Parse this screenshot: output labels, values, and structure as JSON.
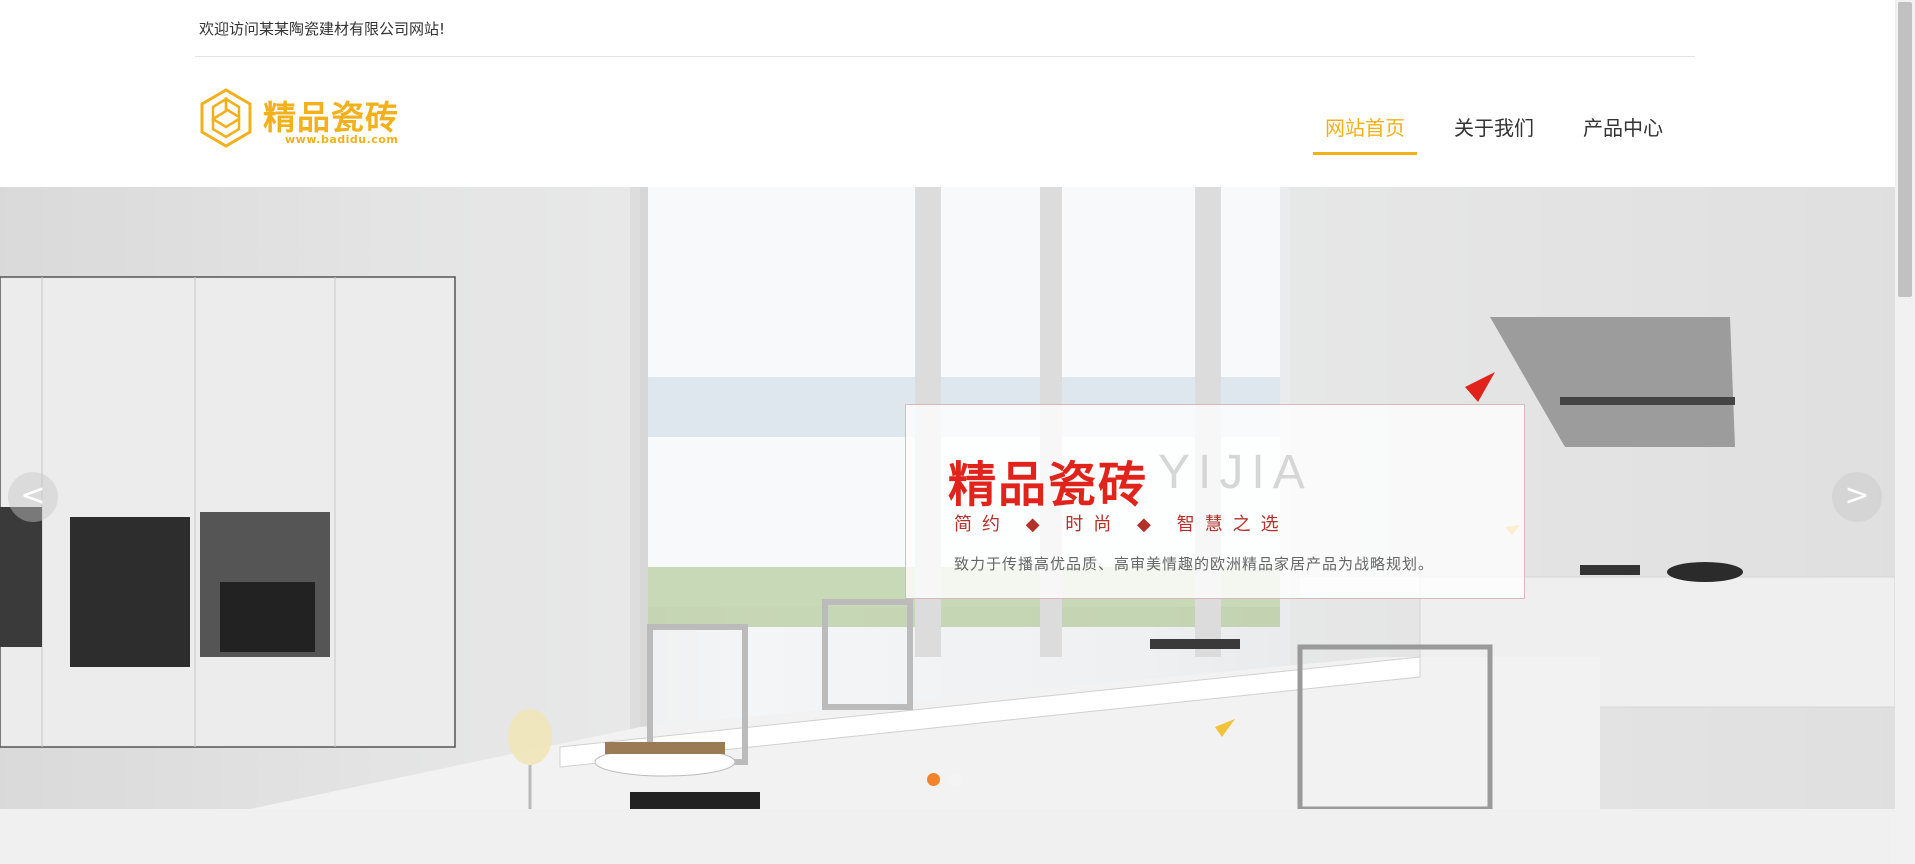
{
  "topbar": {
    "welcome": "欢迎访问某某陶瓷建材有限公司网站!"
  },
  "logo": {
    "text": "精品瓷砖",
    "url": "www.badidu.com",
    "color": "#f2b11b"
  },
  "nav": {
    "items": [
      {
        "label": "网站首页",
        "active": true
      },
      {
        "label": "关于我们",
        "active": false
      },
      {
        "label": "产品中心",
        "active": false
      }
    ],
    "active_color": "#f2b11b"
  },
  "banner": {
    "title": "精品瓷砖",
    "title_en": "YIJIA",
    "slogan": "简约 ◆ 时尚 ◆ 智慧之选",
    "description": "致力于传播高优品质、高审美情趣的欧洲精品家居产品为战略规划。",
    "prev_label": "<",
    "next_label": ">",
    "slides": 2,
    "active_slide": 1,
    "dot_color": "#f1842a"
  }
}
